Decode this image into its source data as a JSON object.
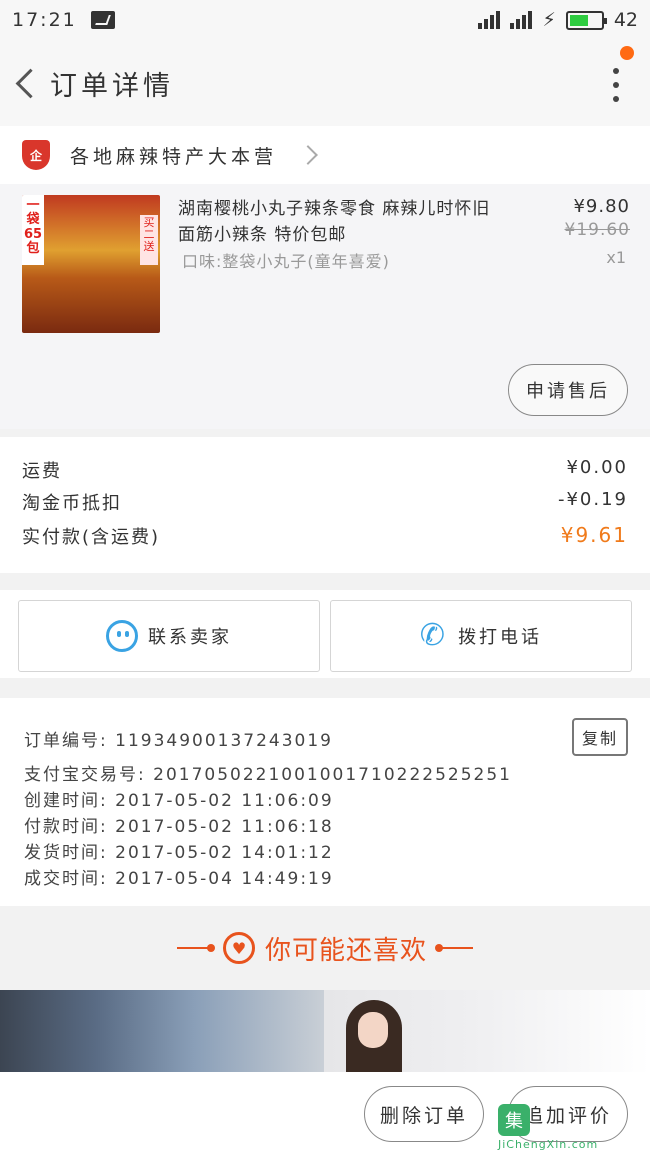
{
  "status_bar": {
    "time": "17:21",
    "battery": "42"
  },
  "header": {
    "title": "订单详情"
  },
  "shop": {
    "badge": "企",
    "name": "各地麻辣特产大本营"
  },
  "product": {
    "image_tag_left": "一袋65包",
    "image_tag_right": "买二送",
    "title": "湖南樱桃小丸子辣条零食 麻辣儿时怀旧面筋小辣条 特价包邮",
    "variant": "口味:整袋小丸子(童年喜爱)",
    "price": "¥9.80",
    "original_price": "¥19.60",
    "quantity": "x1",
    "after_sale_label": "申请售后"
  },
  "costs": [
    {
      "label": "运费",
      "value": "¥0.00"
    },
    {
      "label": "淘金币抵扣",
      "value": "-¥0.19"
    },
    {
      "label": "实付款(含运费)",
      "value": "¥9.61"
    }
  ],
  "contact": {
    "chat_label": "联系卖家",
    "call_label": "拨打电话"
  },
  "order_info": {
    "copy_label": "复制",
    "lines": [
      "订单编号: 1193490013724301­9",
      "支付宝交易号: 2017050221001001710222525251",
      "创建时间: 2017-05-02 11:06:09",
      "付款时间: 2017-05-02 11:06:18",
      "发货时间: 2017-05-02 14:01:12",
      "成交时间: 2017-05-04 14:49:19"
    ]
  },
  "recommend": {
    "title": "你可能还喜欢"
  },
  "bottom": {
    "delete_label": "删除订单",
    "review_label": "追加评价"
  },
  "watermark": {
    "logo": "集",
    "url": "JiChengXin.com"
  },
  "colors": {
    "accent": "#f07a1a",
    "link_blue": "#3aa3e3",
    "rec_orange": "#e8531d"
  }
}
